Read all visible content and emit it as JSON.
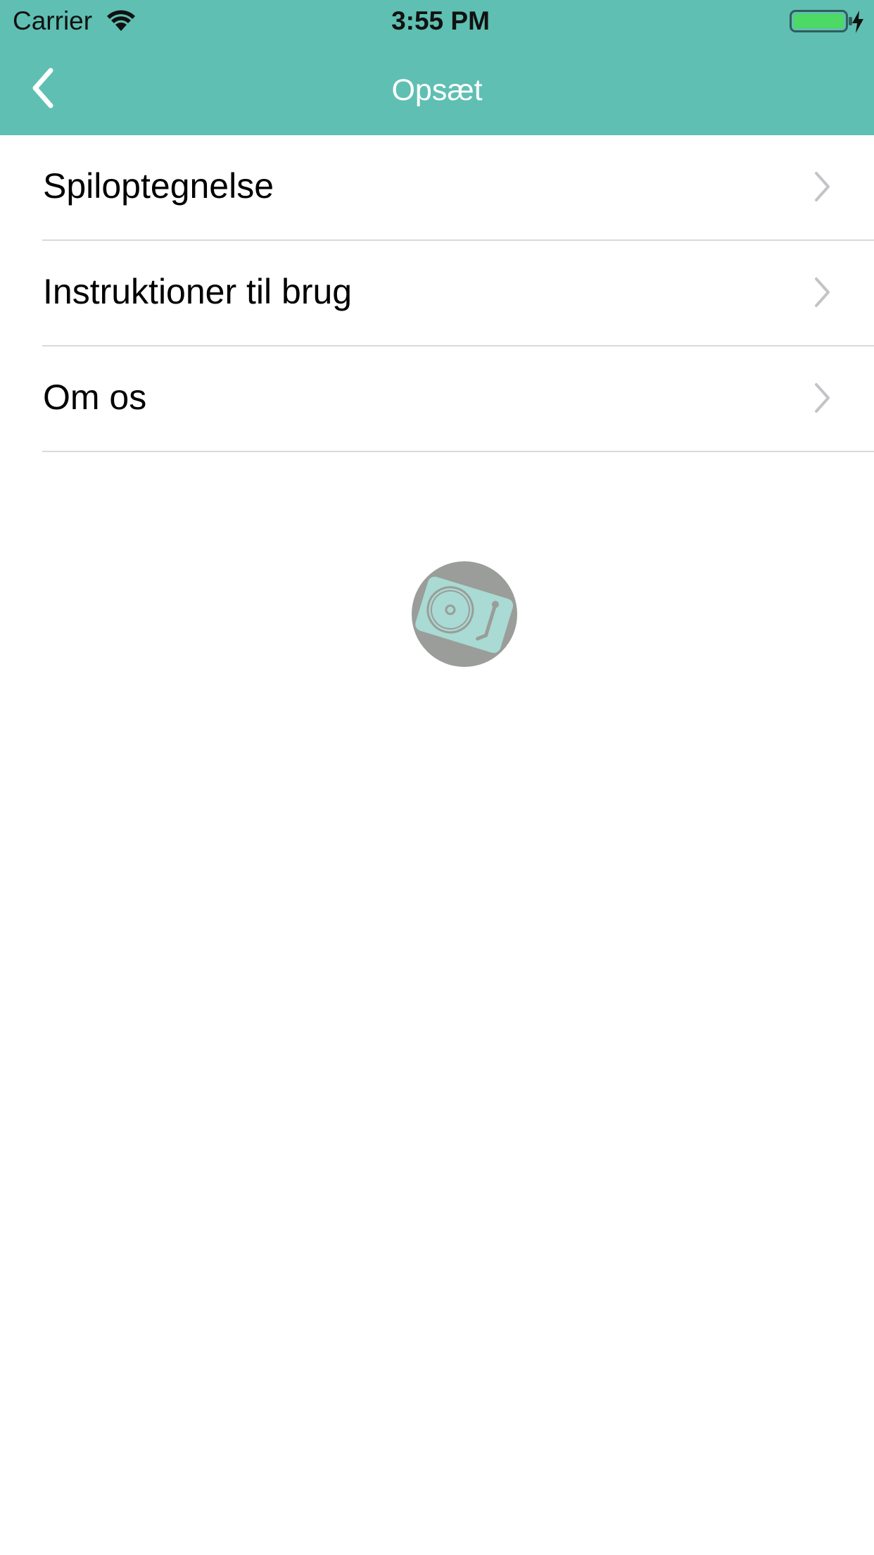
{
  "status_bar": {
    "carrier": "Carrier",
    "time": "3:55 PM",
    "battery_color": "#4cd964"
  },
  "nav": {
    "title": "Opsæt",
    "bar_color": "#5fbfb2"
  },
  "menu": {
    "items": [
      {
        "label": "Spiloptegnelse"
      },
      {
        "label": "Instruktioner til brug"
      },
      {
        "label": "Om os"
      }
    ]
  },
  "icons": {
    "back": "chevron-left-icon",
    "disclosure": "chevron-right-icon",
    "logo": "turntable-logo"
  }
}
